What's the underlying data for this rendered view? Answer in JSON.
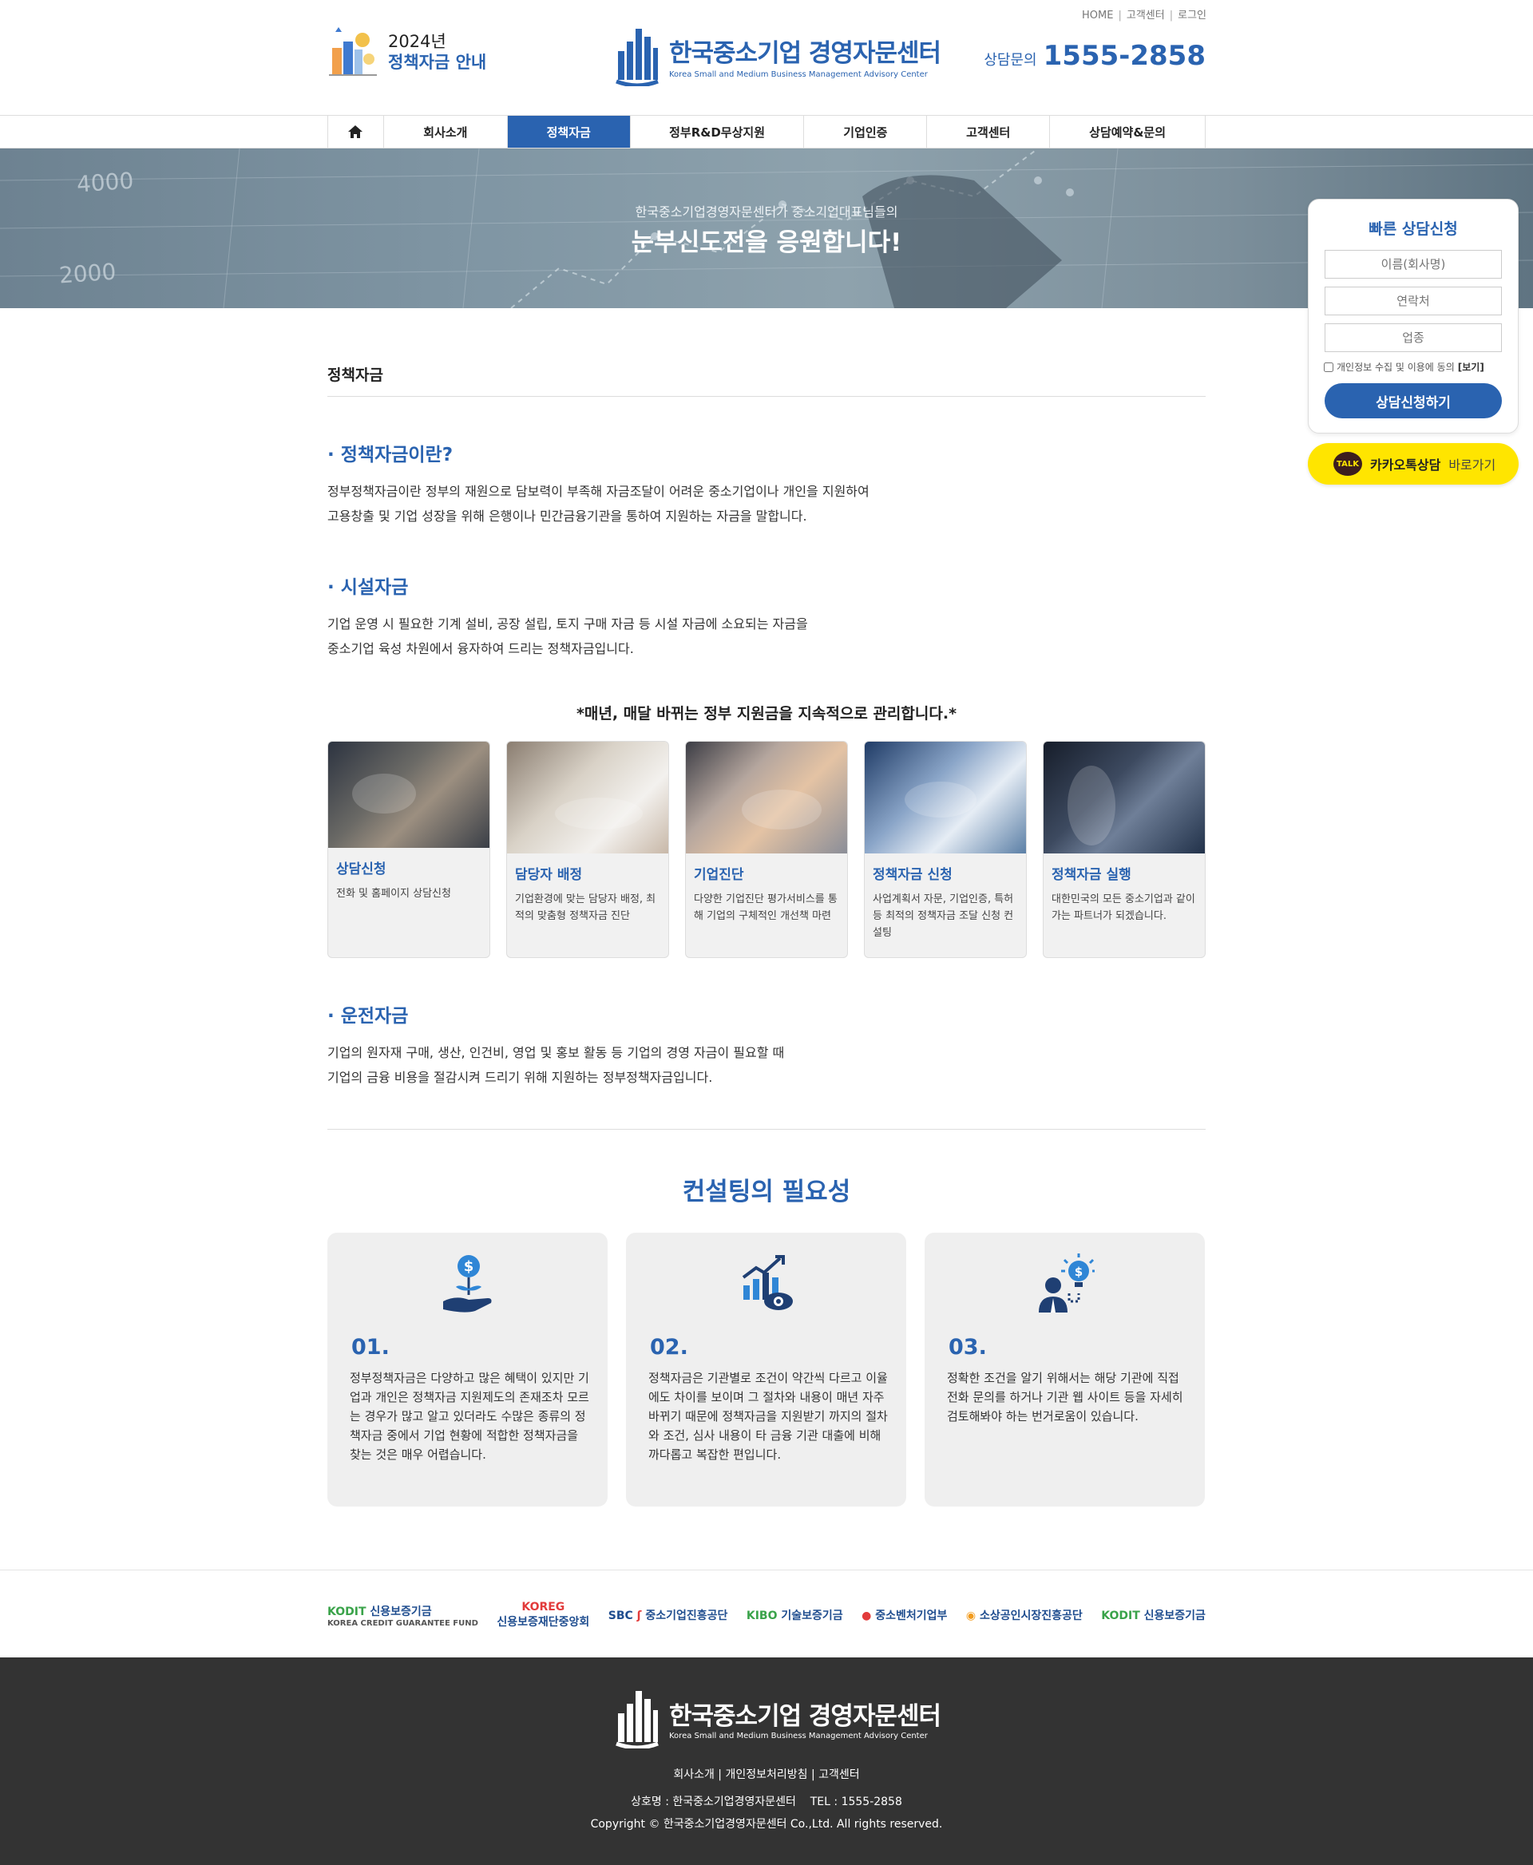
{
  "header": {
    "util_links": [
      "HOME",
      "고객센터",
      "로그인"
    ],
    "promo_year": "2024년",
    "promo_label": "정책자금 안내",
    "brand_name": "한국중소기업 경영자문센터",
    "brand_eng": "Korea Small and Medium Business Management Advisory Center",
    "phone_label": "상담문의",
    "phone_number": "1555-2858"
  },
  "nav": {
    "items": [
      "회사소개",
      "정책자금",
      "정부R&D무상지원",
      "기업인증",
      "고객센터",
      "상담예약&문의"
    ],
    "active": "정책자금"
  },
  "hero": {
    "line1": "한국중소기업경영자문센터가 중소기업대표님들의",
    "line2": "눈부신도전을 응원합니다!",
    "bg_numbers": [
      "4000",
      "2000"
    ]
  },
  "quick_form": {
    "title": "빠른 상담신청",
    "name_placeholder": "이름(회사명)",
    "phone_placeholder": "연락처",
    "industry_placeholder": "업종",
    "agree_text": "개인정보 수집 및 이용에 동의",
    "agree_view": "[보기]",
    "submit": "상담신청하기"
  },
  "kakao": {
    "badge": "TALK",
    "label": "카카오톡상담",
    "action": "바로가기"
  },
  "content": {
    "page_title": "정책자금",
    "sections": [
      {
        "title": "· 정책자금이란?",
        "lines": [
          "정부정책자금이란 정부의 재원으로 담보력이 부족해 자금조달이 어려운 중소기업이나 개인을 지원하여",
          "고용창출 및 기업 성장을 위해 은행이나 민간금융기관을 통하여 지원하는 자금을 말합니다."
        ]
      },
      {
        "title": "· 시설자금",
        "lines": [
          "기업 운영 시 필요한 기계 설비, 공장 설립, 토지 구매 자금 등 시설 자금에 소요되는 자금을",
          "중소기업 육성 차원에서 융자하여 드리는 정책자금입니다."
        ]
      },
      {
        "title": "· 운전자금",
        "lines": [
          "기업의 원자재 구매, 생산, 인건비, 영업 및 홍보 활동 등 기업의 경영 자금이 필요할 때",
          "기업의 금융 비용을 절감시켜 드리기 위해 지원하는 정부정책자금입니다."
        ]
      }
    ],
    "notice": "*매년, 매달 바뀌는 정부 지원금을 지속적으로 관리합니다.*",
    "cards": [
      {
        "title": "상담신청",
        "desc": "전화 및 홈페이지 상담신청"
      },
      {
        "title": "담당자 배정",
        "desc": "기업환경에 맞는 담당자 배정, 최적의 맞춤형 정책자금 진단"
      },
      {
        "title": "기업진단",
        "desc": "다양한 기업진단 평가서비스를 통해 기업의 구체적인 개선책 마련"
      },
      {
        "title": "정책자금 신청",
        "desc": "사업계획서 자문, 기업인증, 특허 등 최적의 정책자금 조달 신청 컨설팅"
      },
      {
        "title": "정책자금 실행",
        "desc": "대한민국의 모든 중소기업과 같이 가는 파트너가 되겠습니다."
      }
    ],
    "need_title": "컨설팅의 필요성",
    "needs": [
      {
        "no": "01.",
        "icon": "money-growth-icon",
        "desc": "정부정책자금은 다양하고 많은 혜택이 있지만 기업과 개인은 정책자금 지원제도의 존재조차 모르는 경우가 많고 알고 있더라도 수많은 종류의 정책자금 중에서 기업 현황에 적합한 정책자금을 찾는 것은 매우 어렵습니다."
      },
      {
        "no": "02.",
        "icon": "chart-eye-icon",
        "desc": "정책자금은 기관별로 조건이 약간씩 다르고 이율에도 차이를 보이며 그 절차와 내용이 매년 자주 바뀌기 때문에 정책자금을 지원받기 까지의 절차와 조건, 심사 내용이 타 금융 기관 대출에 비해 까다롭고 복잡한 편입니다."
      },
      {
        "no": "03.",
        "icon": "idea-person-icon",
        "desc": "정확한 조건을 알기 위해서는 해당 기관에 직접 전화 문의를 하거나 기관 웹 사이트 등을 자세히 검토해봐야 하는 번거로움이 있습니다."
      }
    ]
  },
  "partners": [
    {
      "name": "신용보증기금",
      "mark": "KODIT",
      "sub": "KOREA CREDIT GUARANTEE FUND"
    },
    {
      "name": "신용보증재단중앙회",
      "mark": "KOREG"
    },
    {
      "name": "중소기업진흥공단",
      "mark": "SBC"
    },
    {
      "name": "기술보증기금",
      "mark": "KIBO"
    },
    {
      "name": "중소벤처기업부"
    },
    {
      "name": "소상공인시장진흥공단"
    },
    {
      "name": "신용보증기금",
      "mark": "KODIT"
    }
  ],
  "footer": {
    "brand_name": "한국중소기업 경영자문센터",
    "brand_eng": "Korea Small and Medium Business Management Advisory Center",
    "links": [
      "회사소개",
      "개인정보처리방침",
      "고객센터"
    ],
    "company_label": "상호명 : 한국중소기업경영자문센터",
    "tel": "TEL : 1555-2858",
    "copyright": "Copyright © 한국중소기업경영자문센터 Co.,Ltd. All rights reserved."
  },
  "colors": {
    "primary": "#2a63b0",
    "kakao": "#ffe500",
    "footer_bg": "#333333",
    "card_bg": "#f1f1f1"
  }
}
